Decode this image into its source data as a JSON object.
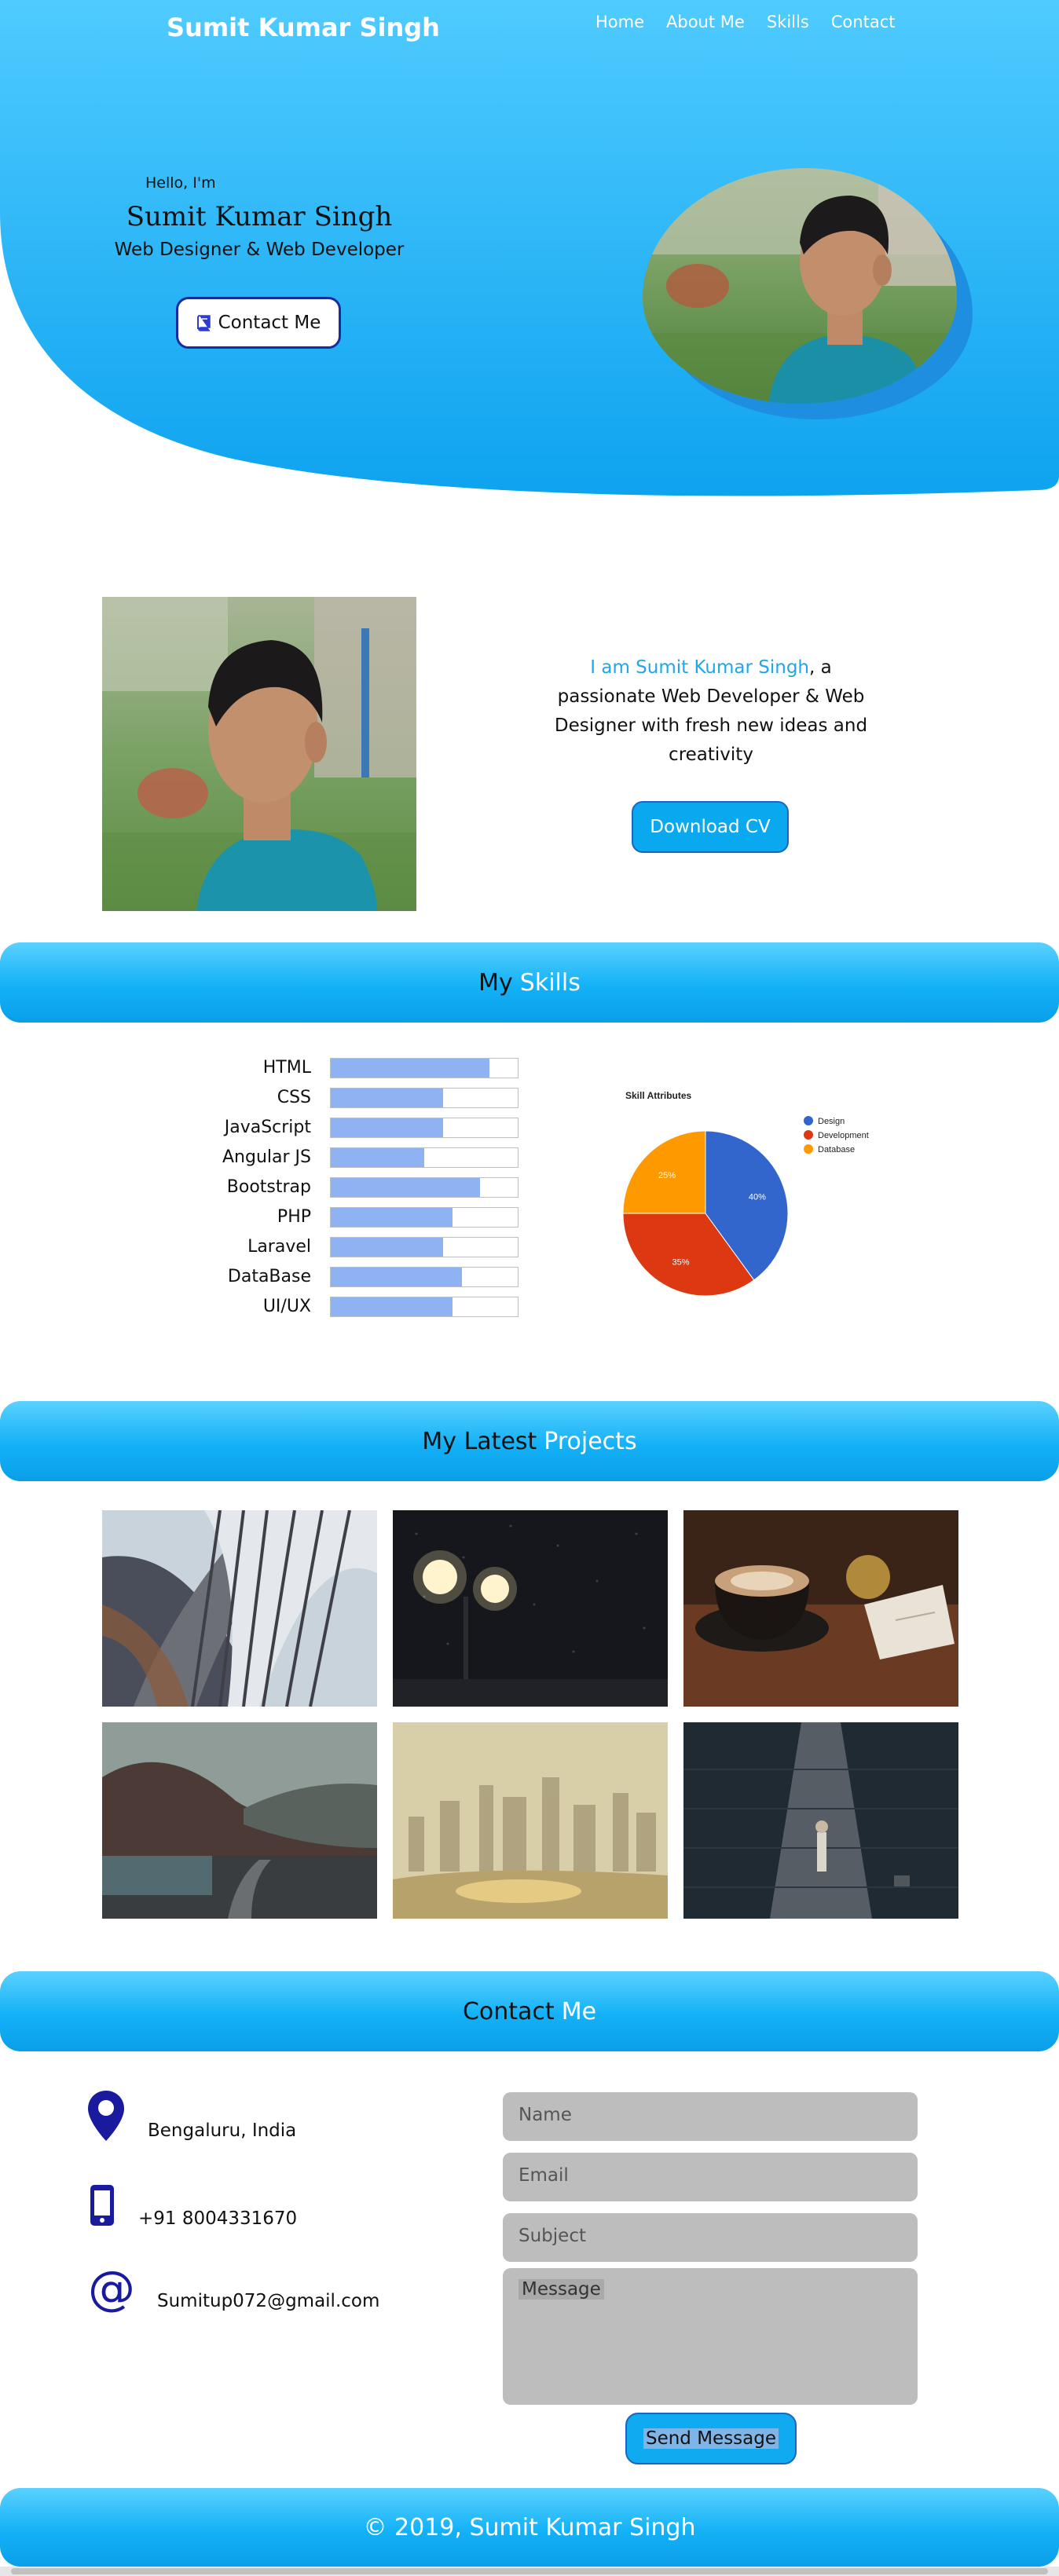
{
  "header": {
    "brand": "Sumit Kumar Singh",
    "nav": [
      "Home",
      "About Me",
      "Skills",
      "Contact"
    ]
  },
  "hero": {
    "greeting": "Hello, I'm",
    "name": "Sumit Kumar Singh",
    "role": "Web Designer & Web Developer",
    "contact_button": "Contact Me"
  },
  "about": {
    "highlight": "I am Sumit Kumar Singh",
    "text": ", a passionate Web Developer & Web Designer with fresh new ideas and creativity",
    "download_button": "Download CV"
  },
  "skills": {
    "heading_a": "My",
    "heading_b": "Skills",
    "items": [
      {
        "name": "HTML",
        "level": 0.85
      },
      {
        "name": "CSS",
        "level": 0.6
      },
      {
        "name": "JavaScript",
        "level": 0.6
      },
      {
        "name": "Angular JS",
        "level": 0.5
      },
      {
        "name": "Bootstrap",
        "level": 0.8
      },
      {
        "name": "PHP",
        "level": 0.65
      },
      {
        "name": "Laravel",
        "level": 0.6
      },
      {
        "name": "DataBase",
        "level": 0.7
      },
      {
        "name": "UI/UX",
        "level": 0.65
      }
    ]
  },
  "chart_data": {
    "type": "pie",
    "title": "Skill Attributes",
    "categories": [
      "Design",
      "Development",
      "Database"
    ],
    "values": [
      40,
      35,
      25
    ],
    "value_labels": [
      "40%",
      "35%",
      "25%"
    ],
    "colors": [
      "#3366cc",
      "#dc3912",
      "#ff9900"
    ],
    "legend": "right"
  },
  "projects": {
    "heading_a": "My Latest",
    "heading_b": "Projects",
    "images": [
      "bookshelf-photo",
      "street-lamps-photo",
      "coffee-cup-photo",
      "mountain-road-photo",
      "foggy-city-photo",
      "dark-alley-photo"
    ]
  },
  "contact": {
    "heading_a": "Contact",
    "heading_b": "Me",
    "location": "Bengaluru, India",
    "phone": "+91 8004331670",
    "email": "Sumitup072@gmail.com",
    "name_placeholder": "Name",
    "email_placeholder": "Email",
    "subject_placeholder": "Subject",
    "message_placeholder": "Message",
    "send_button": "Send Message"
  },
  "footer": {
    "text": "© 2019, Sumit Kumar Singh"
  },
  "colors": {
    "accent": "#13b1f7",
    "highlight_text": "#1fa7ea",
    "icon": "#1a1a9e",
    "skill_bar": "#8fb3f2"
  }
}
